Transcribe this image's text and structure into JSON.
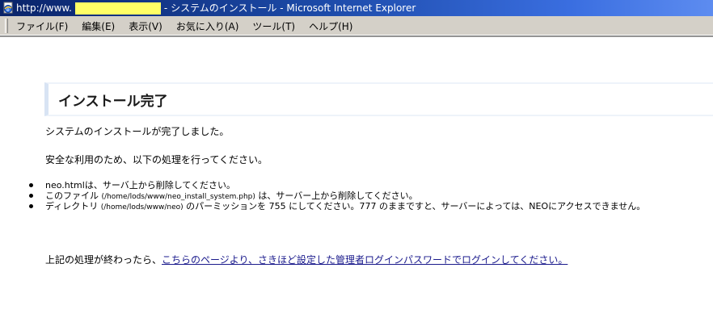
{
  "window": {
    "title_prefix": "http://www.",
    "title_suffix": " - システムのインストール - Microsoft Internet Explorer"
  },
  "menu": {
    "items": [
      "ファイル(F)",
      "編集(E)",
      "表示(V)",
      "お気に入り(A)",
      "ツール(T)",
      "ヘルプ(H)"
    ]
  },
  "page": {
    "heading": "インストール完了",
    "para1": "システムのインストールが完了しました。",
    "para2": "安全な利用のため、以下の処理を行ってください。",
    "bullets": {
      "b1": "neo.htmlは、サーバ上から削除してください。",
      "b2_pre": "このファイル ",
      "b2_path": "(/home/lods/www/neo_install_system.php)",
      "b2_post": " は、サーバー上から削除してください。",
      "b3_pre": "ディレクトリ ",
      "b3_path": "(/home/lods/www/neo)",
      "b3_post": " のパーミッションを 755 にしてください。777 のままですと、サーバーによっては、NEOにアクセスできません。"
    },
    "final_prefix": "上記の処理が終わったら、",
    "final_link": "こちらのページより、さきほど設定した管理者ログインパスワードでログインしてください。"
  },
  "colors": {
    "titlebar_start": "#0a246a",
    "titlebar_end": "#5d8cf0",
    "redaction": "#ffff66",
    "link": "#1a1a8c",
    "heading_accent": "#d8e4f4"
  },
  "icons": {
    "title_icon": "ie-page-icon",
    "bullet": "disc-bullet"
  }
}
